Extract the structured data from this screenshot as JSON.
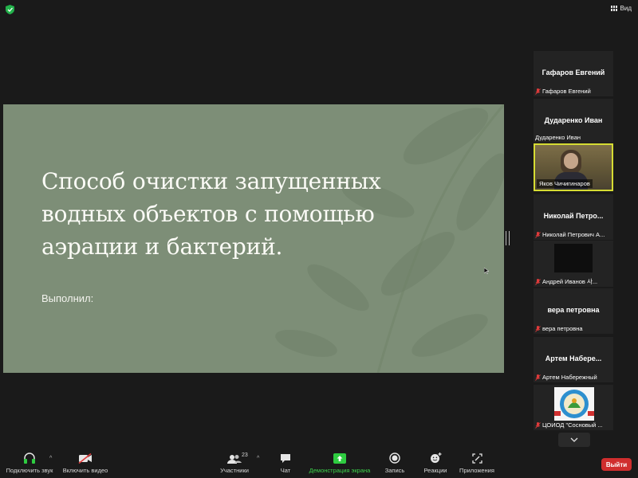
{
  "topbar": {
    "view_label": "Вид"
  },
  "slide": {
    "title_lines": [
      "Способ очистки запущенных",
      "водных объектов с помощью",
      "аэрации и бактерий."
    ],
    "subtitle": "Выполнил:",
    "background_color": "#7d8e77"
  },
  "participants": [
    {
      "display_name": "Гафаров Евгений",
      "tag_name": "Гафаров Евгений",
      "muted": true,
      "type": "name"
    },
    {
      "display_name": "Дударенко Иван",
      "tag_name": "Дударенко Иван",
      "muted": false,
      "type": "name"
    },
    {
      "tag_name": "Яков Чичигинаров",
      "type": "video",
      "speaking": true
    },
    {
      "display_name": "Николай  Петро...",
      "tag_name": "Николай Петрович А...",
      "muted": true,
      "type": "name"
    },
    {
      "tag_name": "Андрей Иванов 사...",
      "muted": true,
      "type": "black"
    },
    {
      "display_name": "вера петровна",
      "tag_name": "вера петровна",
      "muted": true,
      "type": "name"
    },
    {
      "display_name": "Артем  Набере...",
      "tag_name": "Артем Набережный",
      "muted": true,
      "type": "name"
    },
    {
      "tag_name": "ЦОИОД \"Сосновый ...",
      "muted": true,
      "type": "logo"
    }
  ],
  "toolbar": {
    "audio_label": "Подключить звук",
    "video_label": "Включить видео",
    "participants_label": "Участники",
    "participants_count": "23",
    "chat_label": "Чат",
    "share_label": "Демонстрация экрана",
    "record_label": "Запись",
    "reactions_label": "Реакции",
    "apps_label": "Приложения",
    "leave_label": "Выйти"
  },
  "colors": {
    "share_green": "#3dd24b",
    "leave_red": "#d02e2e",
    "active_speaker": "#d6dc33"
  }
}
